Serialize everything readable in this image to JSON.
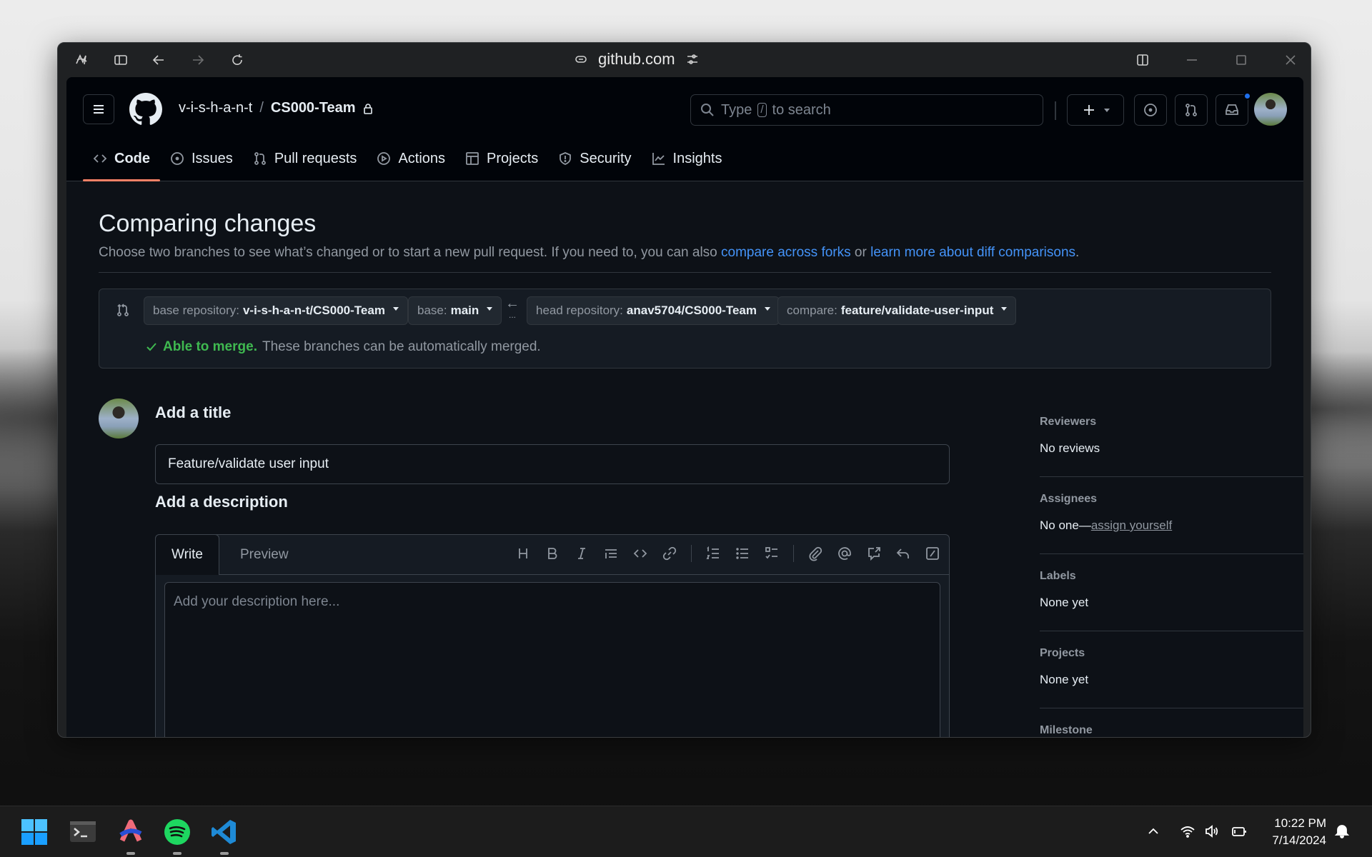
{
  "browser": {
    "url": "github.com",
    "icons": [
      "app-logo-icon",
      "sidebar-toggle-icon",
      "back-icon",
      "forward-icon",
      "reload-icon",
      "link-icon",
      "site-settings-icon",
      "split-view-icon",
      "minimize-icon",
      "maximize-icon",
      "close-icon"
    ]
  },
  "header": {
    "owner": "v-i-s-h-a-n-t",
    "separator": "/",
    "repo": "CS000-Team",
    "search_placeholder_before": "Type",
    "search_key": "/",
    "search_placeholder_after": "to search",
    "notification_dot_color": "#1f6feb"
  },
  "tabs": [
    {
      "label": "Code",
      "icon": "code-icon",
      "active": true
    },
    {
      "label": "Issues",
      "icon": "issue-icon"
    },
    {
      "label": "Pull requests",
      "icon": "pull-request-icon"
    },
    {
      "label": "Actions",
      "icon": "play-icon"
    },
    {
      "label": "Projects",
      "icon": "table-icon"
    },
    {
      "label": "Security",
      "icon": "shield-icon"
    },
    {
      "label": "Insights",
      "icon": "graph-icon"
    }
  ],
  "page": {
    "title": "Comparing changes",
    "subtitle_text": "Choose two branches to see what’s changed or to start a new pull request. If you need to, you can also ",
    "link1": "compare across forks",
    "or": " or ",
    "link2": "learn more about diff comparisons",
    "period": "."
  },
  "compare": {
    "base_repo_label": "base repository:",
    "base_repo_value": "v-i-s-h-a-n-t/CS000-Team",
    "base_label": "base:",
    "base_value": "main",
    "head_repo_label": "head repository:",
    "head_repo_value": "anav5704/CS000-Team",
    "compare_label": "compare:",
    "compare_value": "feature/validate-user-input",
    "arrow": "←",
    "ellipsis": "...",
    "merge_ok": "Able to merge.",
    "merge_text": "These branches can be automatically merged."
  },
  "form": {
    "title_heading": "Add a title",
    "title_value": "Feature/validate user input",
    "desc_heading": "Add a description",
    "write_tab": "Write",
    "preview_tab": "Preview",
    "desc_placeholder": "Add your description here..."
  },
  "sidebar": [
    {
      "heading": "Reviewers",
      "value": "No reviews"
    },
    {
      "heading": "Assignees",
      "value": "No one—",
      "link": "assign yourself"
    },
    {
      "heading": "Labels",
      "value": "None yet"
    },
    {
      "heading": "Projects",
      "value": "None yet"
    },
    {
      "heading": "Milestone",
      "value": ""
    }
  ],
  "taskbar": {
    "apps": [
      "windows-start-icon",
      "terminal-icon",
      "arc-browser-icon",
      "spotify-icon",
      "vscode-icon"
    ],
    "time": "10:22 PM",
    "date": "7/14/2024"
  }
}
